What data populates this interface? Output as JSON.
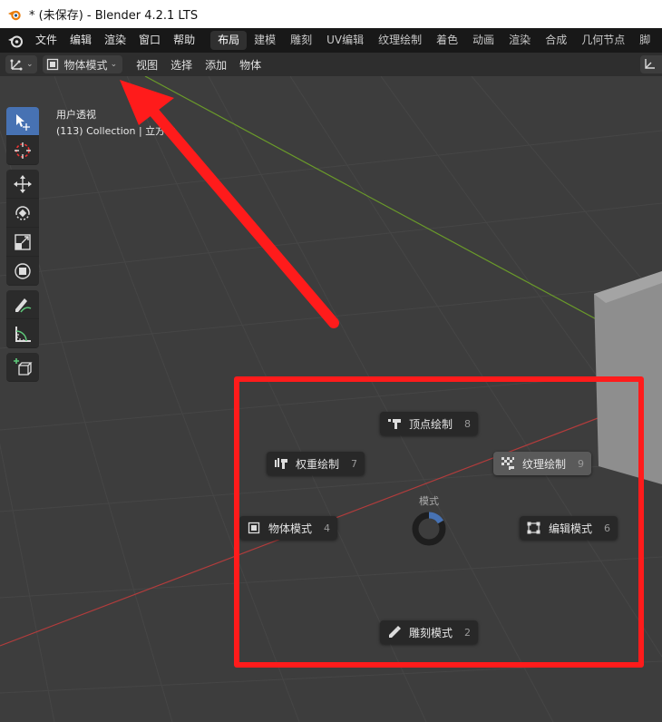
{
  "titlebar": {
    "title": "* (未保存) - Blender 4.2.1 LTS"
  },
  "menubar": {
    "items": [
      "文件",
      "编辑",
      "渲染",
      "窗口",
      "帮助"
    ],
    "workspaces": [
      "布局",
      "建模",
      "雕刻",
      "UV编辑",
      "纹理绘制",
      "着色",
      "动画",
      "渲染",
      "合成",
      "几何节点",
      "脚"
    ],
    "active_workspace": "布局"
  },
  "header": {
    "mode_label": "物体模式",
    "menus": [
      "视图",
      "选择",
      "添加",
      "物体"
    ]
  },
  "viewport": {
    "view_name": "用户透视",
    "collection_info": "(113) Collection | 立方体"
  },
  "pie_menu": {
    "title": "模式",
    "items": {
      "vertex_paint": {
        "label": "顶点绘制",
        "key": "8"
      },
      "weight_paint": {
        "label": "权重绘制",
        "key": "7"
      },
      "texture_paint": {
        "label": "纹理绘制",
        "key": "9"
      },
      "object_mode": {
        "label": "物体模式",
        "key": "4"
      },
      "edit_mode": {
        "label": "编辑模式",
        "key": "6"
      },
      "sculpt_mode": {
        "label": "雕刻模式",
        "key": "2"
      }
    }
  },
  "colors": {
    "annotation_red": "#ff1b1b",
    "active_tool": "#4772b3",
    "x_axis": "#b23c3c",
    "y_axis": "#6a9a2a"
  }
}
